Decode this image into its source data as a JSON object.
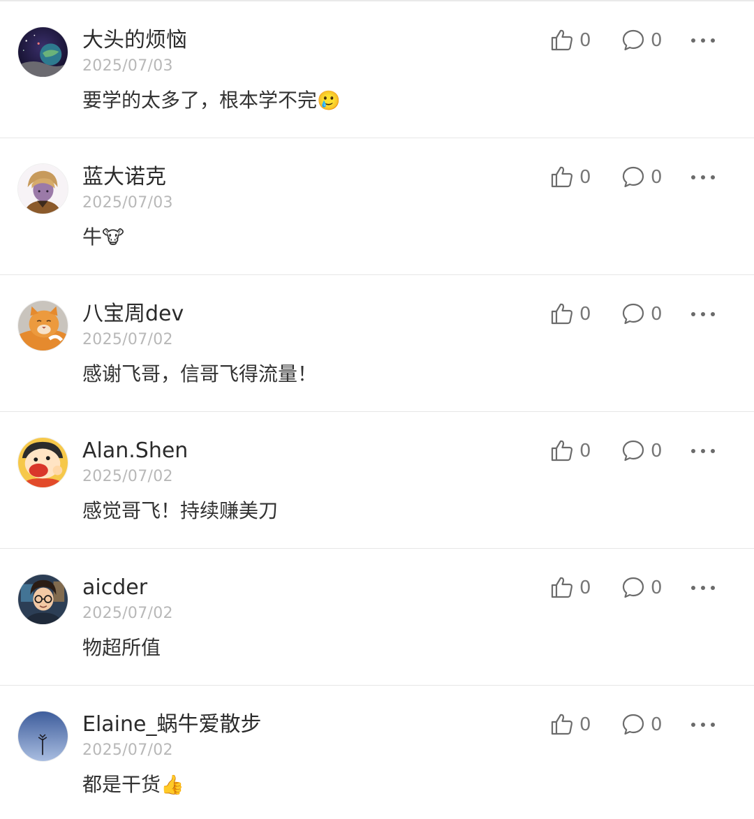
{
  "comments": [
    {
      "username": "大头的烦恼",
      "date": "2025/07/03",
      "text": "要学的太多了，根本学不完",
      "emoji": "🥲",
      "likes": "0",
      "replies": "0",
      "avatar": "space-planet-avatar"
    },
    {
      "username": "蓝大诺克",
      "date": "2025/07/03",
      "text": "牛",
      "emoji": "🐮",
      "likes": "0",
      "replies": "0",
      "avatar": "anime-character-avatar"
    },
    {
      "username": "八宝周dev",
      "date": "2025/07/02",
      "text": "感谢飞哥，信哥飞得流量！",
      "emoji": "",
      "likes": "0",
      "replies": "0",
      "avatar": "orange-cat-avatar"
    },
    {
      "username": "Alan.Shen",
      "date": "2025/07/02",
      "text": "感觉哥飞！持续赚美刀",
      "emoji": "",
      "likes": "0",
      "replies": "0",
      "avatar": "cartoon-boy-avatar"
    },
    {
      "username": "aicder",
      "date": "2025/07/02",
      "text": "物超所值",
      "emoji": "",
      "likes": "0",
      "replies": "0",
      "avatar": "glasses-boy-avatar"
    },
    {
      "username": "Elaine_蜗牛爱散步",
      "date": "2025/07/02",
      "text": "都是干货",
      "emoji": "👍",
      "likes": "0",
      "replies": "0",
      "avatar": "blue-sky-avatar"
    }
  ],
  "icons": {
    "like": "thumbs-up-icon",
    "reply": "comment-bubble-icon",
    "more": "more-dots-icon"
  },
  "colors": {
    "text": "#333333",
    "date": "#b8b8b8",
    "icon": "#6b6b6b",
    "divider": "#e6e6e6"
  }
}
